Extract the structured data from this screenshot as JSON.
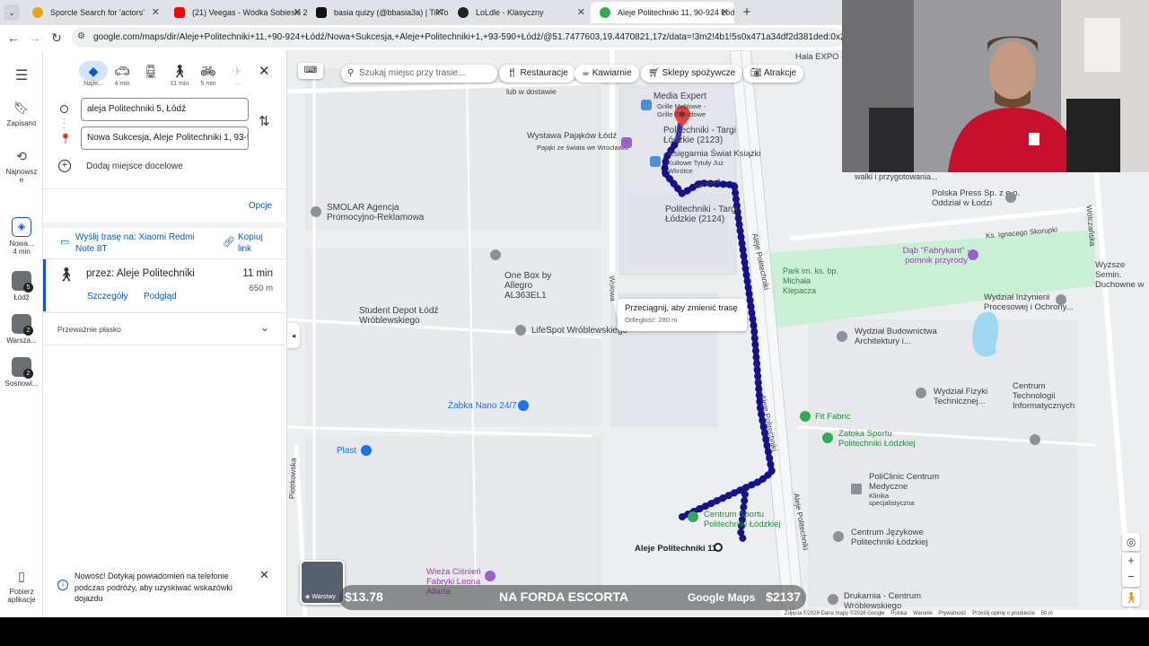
{
  "browser": {
    "tabs": [
      {
        "title": "Sporcle Search for 'actors'",
        "icon_color": "#e8a317"
      },
      {
        "title": "(21) Veegas - Wódka Sobieski 2",
        "icon_color": "#ff0000"
      },
      {
        "title": "basia quizy (@bbasia3a) | TikTo",
        "icon_color": "#111111"
      },
      {
        "title": "LoLdle - Klasyczny",
        "icon_color": "#222222"
      },
      {
        "title": "Aleje Politechniki 11, 90-924 Łód",
        "icon_color": "#34a853"
      }
    ],
    "url": "google.com/maps/dir/Aleje+Politechniki+11,+90-924+Łódź/Nowa+Sukcesja,+Aleje+Politechniki+1,+93-590+Łódź/@51.7477603,19.4470821,17z/data=!3m2!4b1!5s0x471a34df2d381ded:0x27460dad4c03"
  },
  "rail": {
    "saved": "Zapisano",
    "recent": "Najnowsz e",
    "history": [
      {
        "label": "Nowa... 4 min"
      },
      {
        "label": "Łódź",
        "badge": "5"
      },
      {
        "label": "Warsza...",
        "badge": "2"
      },
      {
        "label": "Sosnowi...",
        "badge": "2"
      }
    ],
    "get_app": "Pobierz aplikacje"
  },
  "panel": {
    "modes": [
      {
        "label": "Najle...",
        "icon": "directions-icon"
      },
      {
        "label": "4 min",
        "icon": "car-icon"
      },
      {
        "label": "",
        "icon": "transit-icon"
      },
      {
        "label": "11 min",
        "icon": "walk-icon"
      },
      {
        "label": "5 min",
        "icon": "bike-icon"
      },
      {
        "label": "—",
        "icon": "flight-icon"
      }
    ],
    "origin": "aleja Politechniki 5, Łódź",
    "destination": "Nowa Sukcesja, Aleje Politechniki 1, 93-5",
    "add_destination": "Dodaj miejsce docelowe",
    "options": "Opcje",
    "send_route": "Wyślij trasę na: Xiaomi Redmi Note 8T",
    "copy_link": "Kopiuj link",
    "route": {
      "via": "przez: Aleje Politechniki",
      "time": "11 min",
      "distance": "650 m",
      "details": "Szczegóły",
      "preview": "Podgląd"
    },
    "flat": "Przeważnie płasko",
    "notice": "Nowość! Dotykaj powiadomień na telefonie podczas podróży, aby uzyskiwać wskazówki dojazdu"
  },
  "map": {
    "search_placeholder": "Szukaj miejsc przy trasie...",
    "chips": [
      "Restauracje",
      "Kawiarnie",
      "Sklepy spożywcze",
      "Atrakcje"
    ],
    "tooltip": {
      "title": "Przeciągnij, aby zmienić trasę",
      "sub": "Odległość: 280 m"
    },
    "labels": {
      "media_expert": "Media Expert",
      "grille": "Grille Meblowe - Grille Ogrodowe",
      "wystawa": "Wystawa Pająków Łódź",
      "wystawa_sub": "Pająki ze świata we Wrocławiu",
      "targi1": "Politechniki - Targi Łódzkie (2123)",
      "ksiegarnia": "Księgarnia Świat Książki",
      "ksiegarnia_sub": "Kultowe Tytuły Już Wkrótce",
      "targi2": "Politechniki - Targi Łódzkie (2124)",
      "smolar": "SMOLAR Agencja Promocyjno-Reklamowa",
      "onebox": "One Box by Allegro AL363EL1",
      "student": "Student Depot Łódź Wróblewskiego",
      "lifespot": "LifeSpot Wróblewskiego",
      "zabka": "Żabka Nano 24/7",
      "plast": "Plast",
      "wolowa": "Wołowa",
      "aleje": "Aleje Politechniki",
      "park": "Park im. ks. bp. Michała Klepacza",
      "dab": "Dąb \"Fabrykant\" - pomnik przyrody",
      "press": "Polska Press Sp. z o.o. Oddział w Łodzi",
      "skorupki": "Ks. Ignacego Skorupki",
      "wydzial_inz": "Wydział Inżynierii Procesowej i Ochrony...",
      "wydzial_bud": "Wydział Budownictwa Architektury i...",
      "fizyki": "Wydział Fizyki Technicznej...",
      "centrum_it": "Centrum Technologii Informatycznych",
      "fitfabric": "Fit Fabric",
      "zatoka": "Zatoka Sportu Politechniki Łódzkiej",
      "policlinic": "PoliClinic Centrum Medyczne",
      "policlinic_sub": "Klinika specjalistyczna",
      "centrum_sportu": "Centrum Sportu Politechniki Łódzkiej",
      "jezykowe": "Centrum Językowe Politechniki Łódzkiej",
      "origin_label": "Aleje Politechniki 11",
      "wieza": "Wieża Ciśnień Fabryki Leona Allarta",
      "drukarnia": "Drukarnia - Centrum Wróblewskiego",
      "hala": "Hala EXPO Łódź",
      "walki": "walki i przygotowania...",
      "wolczanska": "Wólczańska",
      "wyzsze": "Wyższe Semin. Duchowne w",
      "piotrkowska": "Piotrkowska",
      "lub": "lub w dostawie"
    },
    "layers": "Warstwy",
    "footer": {
      "copyright": "Zdjęcia ©2026 Dane mapy ©2026 Google",
      "country": "Polska",
      "terms": "Warunki",
      "privacy": "Prywatność",
      "feedback": "Prześlij opinię o produkcie",
      "scale": "50 m",
      "logo": "Google Maps"
    }
  },
  "overlay": {
    "left_price": "$13.78",
    "title": "NA FORDA ESCORTA",
    "right_price": "$2137"
  }
}
